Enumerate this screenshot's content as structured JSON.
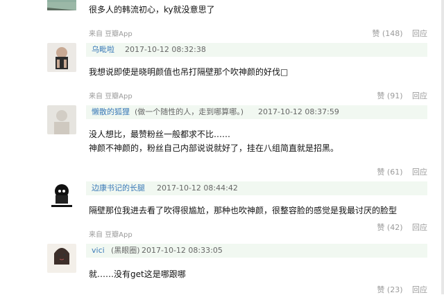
{
  "comments": [
    {
      "avatar_icon": "avatar-top-partial",
      "text_lines": [
        "很多人的韩流初心，ky就没意思了"
      ],
      "source": "来自 豆瓣App",
      "likes_label": "赞 (148)",
      "reply_label": "回应"
    },
    {
      "username": "乌毗啦",
      "timestamp": "2017-10-12 08:32:38",
      "text_lines": [
        "我想说即使是晓明颜值也吊打隔壁那个吹神颜的好伐□"
      ],
      "source": "来自 豆瓣App",
      "likes_label": "赞 (91)",
      "reply_label": "回应"
    },
    {
      "username": "懒散的狐狸",
      "signature": "(做一个随性的人，走到哪算哪。)",
      "timestamp": "2017-10-12 08:37:59",
      "text_lines": [
        "没人想比，最赞粉丝一般都求不比……",
        "神颜不神颜的，粉丝自己内部说说就好了，挂在八组简直就是招黑。"
      ],
      "likes_label": "赞 (61)",
      "reply_label": "回应"
    },
    {
      "username": "边康书记的长腿",
      "timestamp": "2017-10-12 08:44:42",
      "text_lines": [
        "隔壁那位我进去看了吹得很尴尬，那种也吹神颜，很整容脸的感觉是我最讨厌的脸型"
      ],
      "source": "来自 豆瓣App",
      "likes_label": "赞 (42)",
      "reply_label": "回应"
    },
    {
      "username": "vici",
      "signature": "(黑眼圈)",
      "timestamp": "2017-10-12 08:33:05",
      "text_lines": [
        "就……没有get这是哪跟哪"
      ],
      "likes_label": "赞 (23)",
      "reply_label": "回应"
    }
  ],
  "colors": {
    "username": "#3b7ab8",
    "meta_bar_bg": "#f1f8f1",
    "muted_text": "#9a9a9a",
    "body_text": "#111111"
  }
}
